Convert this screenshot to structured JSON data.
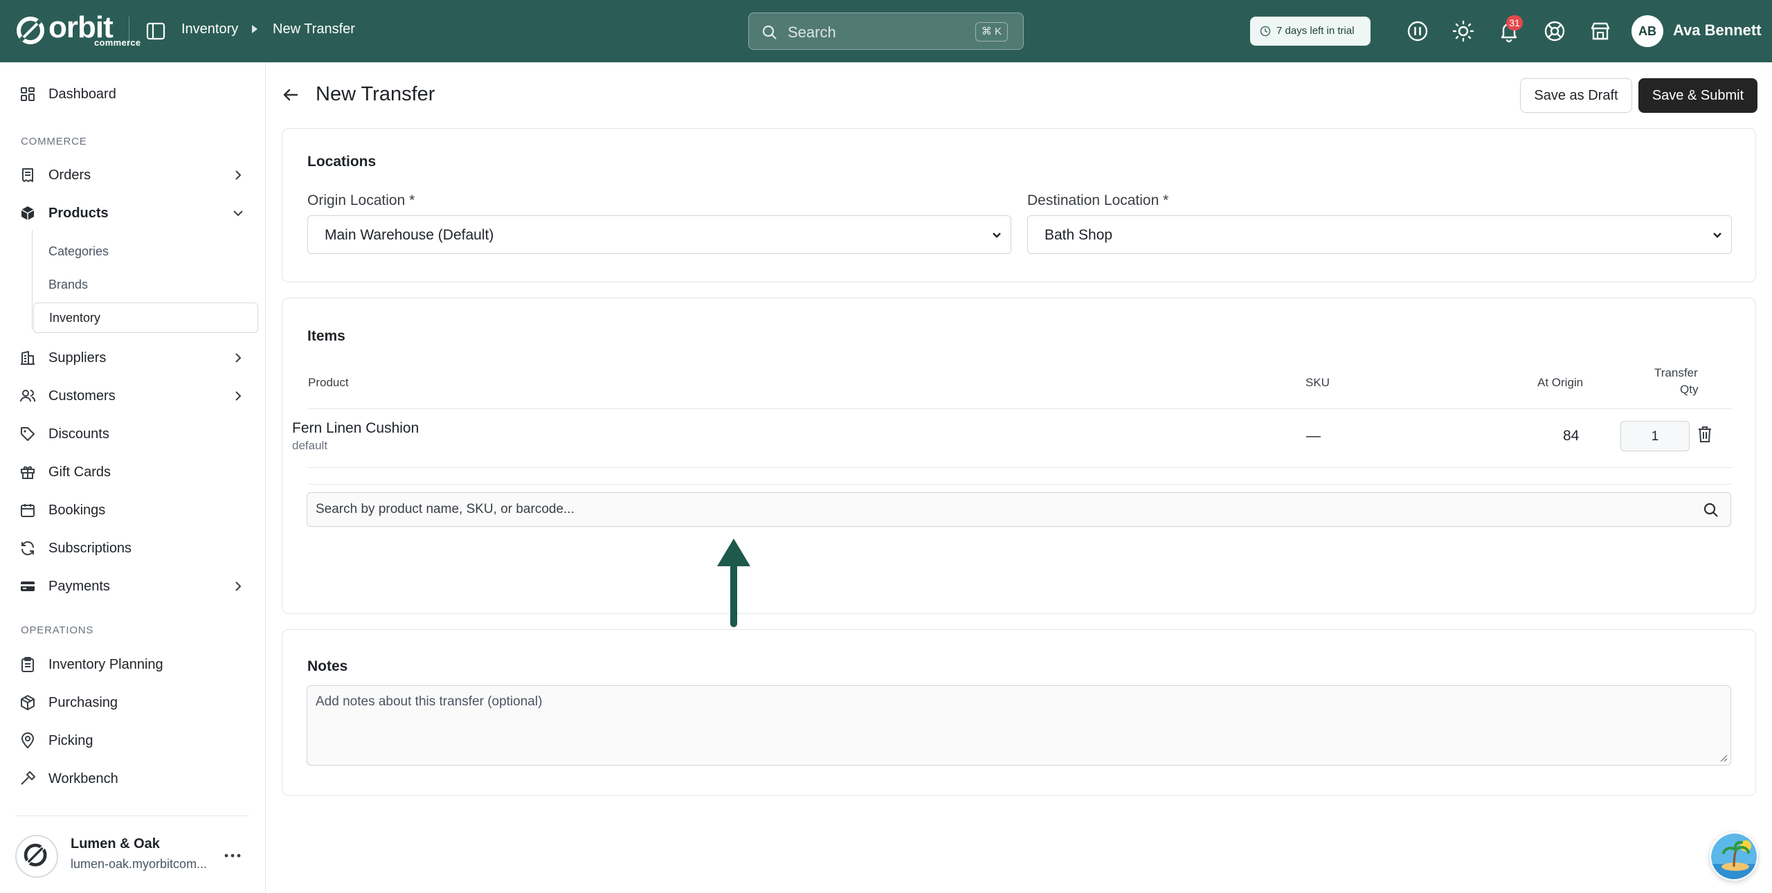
{
  "app": {
    "logo_text": "orbit",
    "logo_sub": "commerce"
  },
  "topbar": {
    "breadcrumb": [
      "Inventory",
      "New Transfer"
    ],
    "search_placeholder": "Search",
    "search_shortcut": "⌘ K",
    "trial_text": "7 days left in trial",
    "notification_count": "31",
    "user_initials": "AB",
    "user_name": "Ava Bennett"
  },
  "sidebar": {
    "dashboard": "Dashboard",
    "section_commerce": "COMMERCE",
    "orders": "Orders",
    "products": "Products",
    "products_sub": [
      "Categories",
      "Brands",
      "Inventory"
    ],
    "suppliers": "Suppliers",
    "customers": "Customers",
    "discounts": "Discounts",
    "gift_cards": "Gift Cards",
    "bookings": "Bookings",
    "subscriptions": "Subscriptions",
    "payments": "Payments",
    "section_operations": "OPERATIONS",
    "inventory_planning": "Inventory Planning",
    "purchasing": "Purchasing",
    "picking": "Picking",
    "workbench": "Workbench",
    "store_name": "Lumen & Oak",
    "store_url": "lumen-oak.myorbitcom..."
  },
  "page": {
    "title": "New Transfer",
    "save_draft": "Save as Draft",
    "save_submit": "Save & Submit"
  },
  "locations": {
    "title": "Locations",
    "origin_label": "Origin Location *",
    "origin_value": "Main Warehouse (Default)",
    "destination_label": "Destination Location *",
    "destination_value": "Bath Shop"
  },
  "items": {
    "title": "Items",
    "columns": {
      "product": "Product",
      "sku": "SKU",
      "at_origin": "At Origin",
      "transfer_qty_1": "Transfer",
      "transfer_qty_2": "Qty"
    },
    "rows": [
      {
        "product": "Fern Linen Cushion",
        "variant": "default",
        "sku": "—",
        "at_origin": "84",
        "qty": "1"
      }
    ],
    "search_placeholder": "Search by product name, SKU, or barcode..."
  },
  "notes": {
    "title": "Notes",
    "placeholder": "Add notes about this transfer (optional)"
  },
  "colors": {
    "topbar": "#2b5d56",
    "accent_arrow": "#1d5a4c",
    "primary_button": "#242424",
    "badge": "#e5484d"
  }
}
